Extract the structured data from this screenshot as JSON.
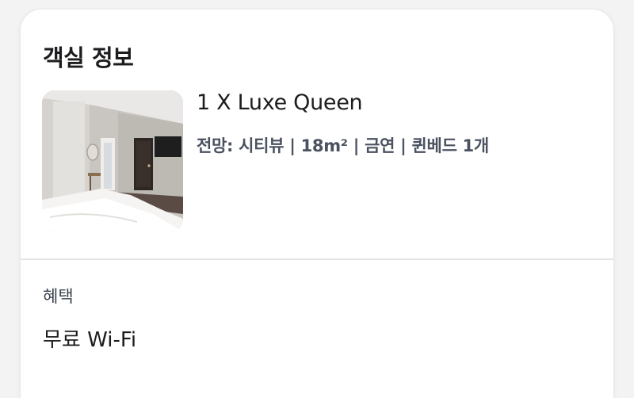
{
  "room_info": {
    "section_title": "객실 정보",
    "room_name": "1 X Luxe Queen",
    "room_specs": "전망: 시티뷰 | 18m² | 금연 | 퀸베드 1개",
    "thumbnail_icon": "hotel-room-photo"
  },
  "benefits": {
    "label": "혜택",
    "value": "무료 Wi-Fi"
  }
}
